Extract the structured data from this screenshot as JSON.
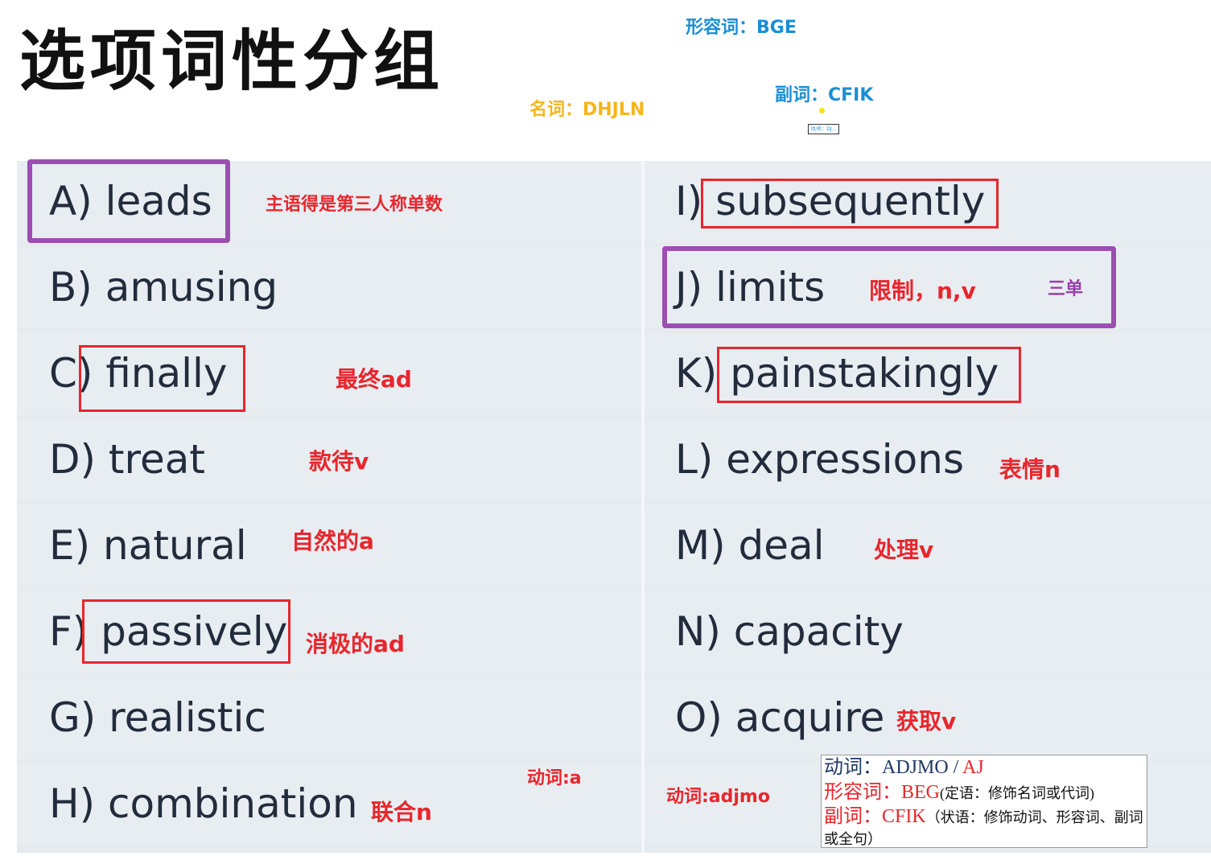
{
  "title": "选项词性分组",
  "categories": {
    "adjective": "形容词：BGE",
    "noun": "名词：DHJLN",
    "adverb": "副词：CFIK",
    "tiny_box": "动/名：DJ…"
  },
  "options_left": [
    {
      "label": "A) leads"
    },
    {
      "label": "B) amusing"
    },
    {
      "label": "C) finally"
    },
    {
      "label": "D) treat"
    },
    {
      "label": "E) natural"
    },
    {
      "label": "F) passively"
    },
    {
      "label": "G) realistic"
    },
    {
      "label": "H) combination"
    }
  ],
  "options_right": [
    {
      "label": "I) subsequently"
    },
    {
      "label": "J) limits"
    },
    {
      "label": "K) painstakingly"
    },
    {
      "label": "L) expressions"
    },
    {
      "label": "M) deal"
    },
    {
      "label": "N) capacity"
    },
    {
      "label": "O) acquire"
    }
  ],
  "notes": {
    "a": "主语得是第三人称单数",
    "c": "最终ad",
    "d": "款待v",
    "e": "自然的a",
    "f": "消极的ad",
    "h": "联合n",
    "j": "限制，n,v",
    "j2": "三单",
    "l": "表情n",
    "m": "处理v",
    "o": "获取v",
    "verb_a": "动词:a",
    "verb_adjmo": "动词:adjmo"
  },
  "summary": {
    "verb_label": "动词：",
    "verb_value": "ADJMO / ",
    "verb_value_red": "AJ",
    "adj_label": "形容词：",
    "adj_value": "BEG",
    "adj_note": "(定语：修饰名词或代词)",
    "adv_label": "副词：",
    "adv_value": "CFIK",
    "adv_note": "（状语：修饰动词、形容词、副词或全句）"
  },
  "colors": {
    "red": "#e8262c",
    "purple": "#9b4fb0",
    "blue": "#1a8fd6",
    "yellow": "#f5b51c"
  }
}
